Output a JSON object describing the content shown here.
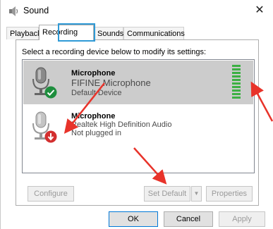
{
  "window": {
    "title": "Sound",
    "close_glyph": "✕"
  },
  "tabs": [
    {
      "label": "Playback"
    },
    {
      "label": "Recording"
    },
    {
      "label": "Sounds"
    },
    {
      "label": "Communications"
    }
  ],
  "instruction": "Select a recording device below to modify its settings:",
  "devices": [
    {
      "name": "Microphone",
      "line1": "FIFINE Microphone",
      "line2": "Default Device",
      "status_icon": "green-check-icon",
      "selected": true
    },
    {
      "name": "Microphone",
      "line1": "Realtek High Definition Audio",
      "line2": "Not plugged in",
      "status_icon": "red-down-arrow-icon",
      "selected": false
    }
  ],
  "buttons": {
    "configure": "Configure",
    "set_default": "Set Default",
    "dropdown_glyph": "▼",
    "properties": "Properties",
    "ok": "OK",
    "cancel": "Cancel",
    "apply": "Apply"
  },
  "colors": {
    "accent": "#2f9ad6",
    "annotation_arrow": "#e8332a",
    "meter_green": "#3cb043",
    "selected_row": "#cccccc"
  }
}
